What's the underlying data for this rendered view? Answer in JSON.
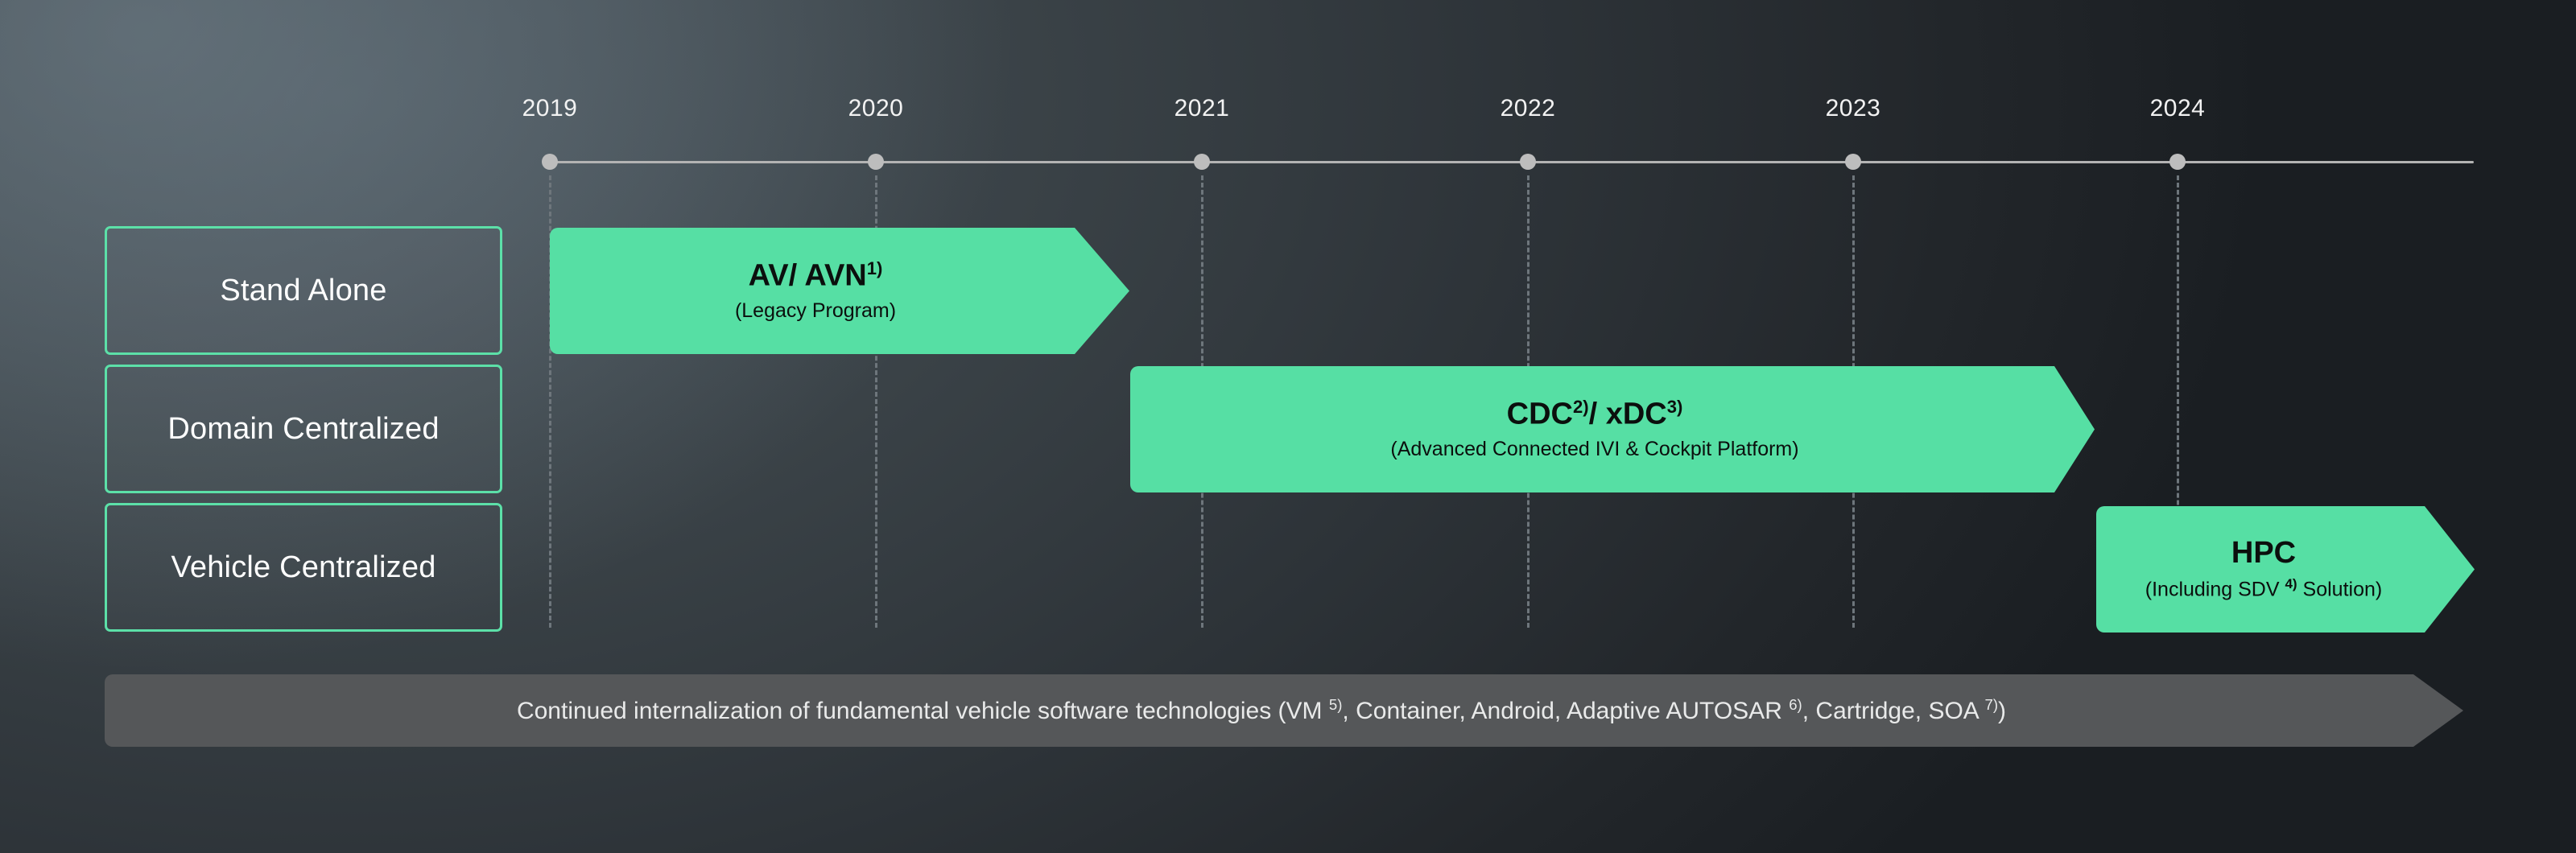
{
  "colors": {
    "accent_green": "#56dfa4",
    "box_outline_green": "#5ce0a8",
    "footer_gray": "#555759",
    "timeline_gray": "#b3b3b3",
    "text_white": "#ffffff",
    "arrow_text_black": "#0b0f0d"
  },
  "timeline": {
    "years": [
      "2019",
      "2020",
      "2021",
      "2022",
      "2023",
      "2024"
    ]
  },
  "categories": [
    {
      "label": "Stand Alone"
    },
    {
      "label": "Domain Centralized"
    },
    {
      "label": "Vehicle Centralized"
    }
  ],
  "phases": [
    {
      "title_main": "AV/ AVN",
      "title_sup": "1)",
      "title_tail": "",
      "title_main2": "",
      "title_sup2": "",
      "subtitle_pre": "(Legacy Program)",
      "subtitle_sup": "",
      "subtitle_post": ""
    },
    {
      "title_main": "CDC",
      "title_sup": "2)",
      "title_tail": "/ xDC",
      "title_main2": "",
      "title_sup2": "3)",
      "subtitle_pre": "(Advanced Connected IVI & Cockpit Platform)",
      "subtitle_sup": "",
      "subtitle_post": ""
    },
    {
      "title_main": "HPC",
      "title_sup": "",
      "title_tail": "",
      "title_main2": "",
      "title_sup2": "",
      "subtitle_pre": "(Including SDV ",
      "subtitle_sup": "4)",
      "subtitle_post": " Solution)"
    }
  ],
  "footer": {
    "text_part1": "Continued internalization of fundamental vehicle software technologies (VM ",
    "sup1": "5)",
    "text_part2": ", Container, Android, Adaptive AUTOSAR ",
    "sup2": "6)",
    "text_part3": ", Cartridge, SOA ",
    "sup3": "7)",
    "text_part4": ")"
  }
}
